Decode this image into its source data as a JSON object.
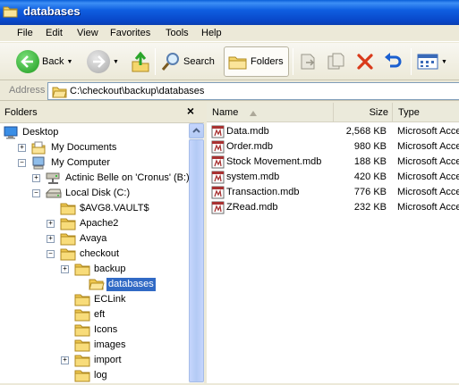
{
  "window": {
    "title": "databases"
  },
  "menu": [
    "File",
    "Edit",
    "View",
    "Favorites",
    "Tools",
    "Help"
  ],
  "toolbar": {
    "back_label": "Back",
    "search_label": "Search",
    "folders_label": "Folders"
  },
  "address": {
    "label": "Address",
    "path": "C:\\checkout\\backup\\databases"
  },
  "folders_pane": {
    "title": "Folders",
    "close": "×",
    "tree": [
      {
        "label": "Desktop",
        "icon": "desktop-icon",
        "expander": ""
      },
      {
        "label": "My Documents",
        "icon": "my-documents-icon",
        "expander": "+"
      },
      {
        "label": "My Computer",
        "icon": "my-computer-icon",
        "expander": "−"
      },
      {
        "label": "Actinic Belle on 'Cronus' (B:)",
        "icon": "network-drive-icon",
        "expander": "+"
      },
      {
        "label": "Local Disk (C:)",
        "icon": "local-disk-icon",
        "expander": "−"
      },
      {
        "label": "$AVG8.VAULT$",
        "icon": "folder-icon",
        "expander": ""
      },
      {
        "label": "Apache2",
        "icon": "folder-icon",
        "expander": "+"
      },
      {
        "label": "Avaya",
        "icon": "folder-icon",
        "expander": "+"
      },
      {
        "label": "checkout",
        "icon": "folder-icon",
        "expander": "−"
      },
      {
        "label": "backup",
        "icon": "folder-icon",
        "expander": "+"
      },
      {
        "label": "databases",
        "icon": "open-folder-icon",
        "expander": ""
      },
      {
        "label": "ECLink",
        "icon": "folder-icon",
        "expander": ""
      },
      {
        "label": "eft",
        "icon": "folder-icon",
        "expander": ""
      },
      {
        "label": "Icons",
        "icon": "folder-icon",
        "expander": ""
      },
      {
        "label": "images",
        "icon": "folder-icon",
        "expander": ""
      },
      {
        "label": "import",
        "icon": "folder-icon",
        "expander": "+"
      },
      {
        "label": "log",
        "icon": "folder-icon",
        "expander": ""
      }
    ]
  },
  "files_pane": {
    "columns": {
      "name": "Name",
      "size": "Size",
      "type": "Type"
    },
    "rows": [
      {
        "name": "Data.mdb",
        "size": "2,568 KB",
        "type": "Microsoft Acce"
      },
      {
        "name": "Order.mdb",
        "size": "980 KB",
        "type": "Microsoft Acce"
      },
      {
        "name": "Stock Movement.mdb",
        "size": "188 KB",
        "type": "Microsoft Acce"
      },
      {
        "name": "system.mdb",
        "size": "420 KB",
        "type": "Microsoft Acce"
      },
      {
        "name": "Transaction.mdb",
        "size": "776 KB",
        "type": "Microsoft Acce"
      },
      {
        "name": "ZRead.mdb",
        "size": "232 KB",
        "type": "Microsoft Acce"
      }
    ]
  },
  "colors": {
    "titlebar": "#0a5fd8",
    "selection": "#316ac5",
    "folder": "#f5d66c"
  }
}
